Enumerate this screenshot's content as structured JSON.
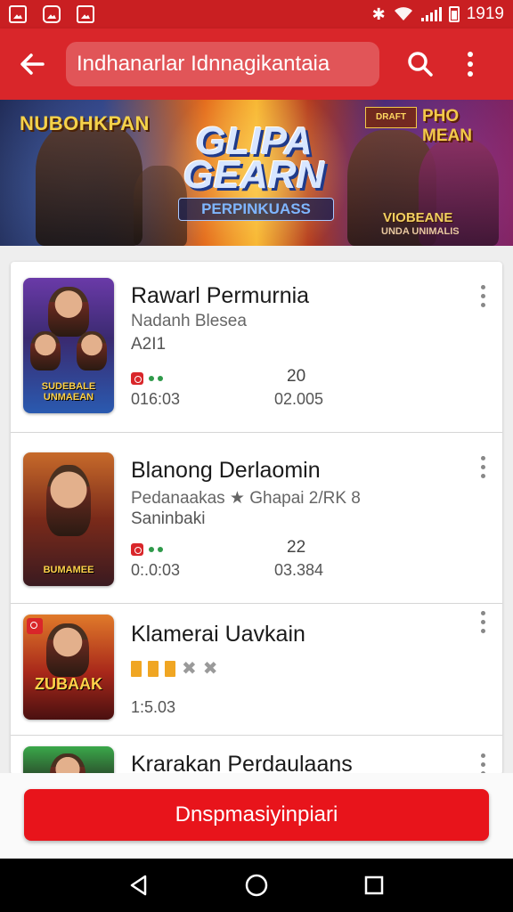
{
  "status_bar": {
    "time": "1919",
    "icons": [
      "gallery-icon",
      "notification-icon",
      "image-icon",
      "bluetooth-icon",
      "wifi-icon",
      "signal-icon",
      "battery-icon"
    ]
  },
  "app_bar": {
    "back_icon": "arrow-left-icon",
    "search_value": "Indhanarlar Idnnagikantaia",
    "search_icon": "search-icon",
    "menu_icon": "more-vert-icon",
    "color": "#d9262a"
  },
  "banner": {
    "top_left": "NUBOHKPAN",
    "title": "GLIPA GEARN",
    "subtitle": "PERPINKUASS",
    "top_right": "PHO MEAN",
    "badge": "DRAFT",
    "bottom_right_1": "VIOBEANE",
    "bottom_right_2": "UNDA UNIMALIS"
  },
  "items": [
    {
      "title": "Rawarl Permurnia",
      "subtitle": "Nadanh Blesea",
      "extra": "A2I1",
      "thumb_label": "SUDEBALE UNMAEAN",
      "time": "016:03",
      "count": "20",
      "count_sub": "02.005"
    },
    {
      "title": "Blanong Derlaomin",
      "subtitle": "Pedanaakas ★ Ghapai 2/RK 8",
      "extra": "Saninbaki",
      "thumb_label": "BUMAMEE",
      "time": "0:.0:03",
      "count": "22",
      "count_sub": "03.384"
    },
    {
      "title": "Klamerai Uavkain",
      "subtitle": "",
      "extra": "",
      "thumb_label": "ZUBAAK",
      "time": "1:5.03",
      "count": "",
      "count_sub": "",
      "rating_filled": 3,
      "rating_total": 5
    },
    {
      "title": "Krarakan Perdaulaans",
      "subtitle": "",
      "extra": "",
      "thumb_label": "",
      "time": "",
      "count": "",
      "count_sub": ""
    }
  ],
  "cta": {
    "label": "Dnspmasiyinpiari",
    "color": "#e8141b"
  },
  "nav": {
    "back_icon": "nav-back-icon",
    "home_icon": "nav-home-icon",
    "recents_icon": "nav-recents-icon"
  }
}
